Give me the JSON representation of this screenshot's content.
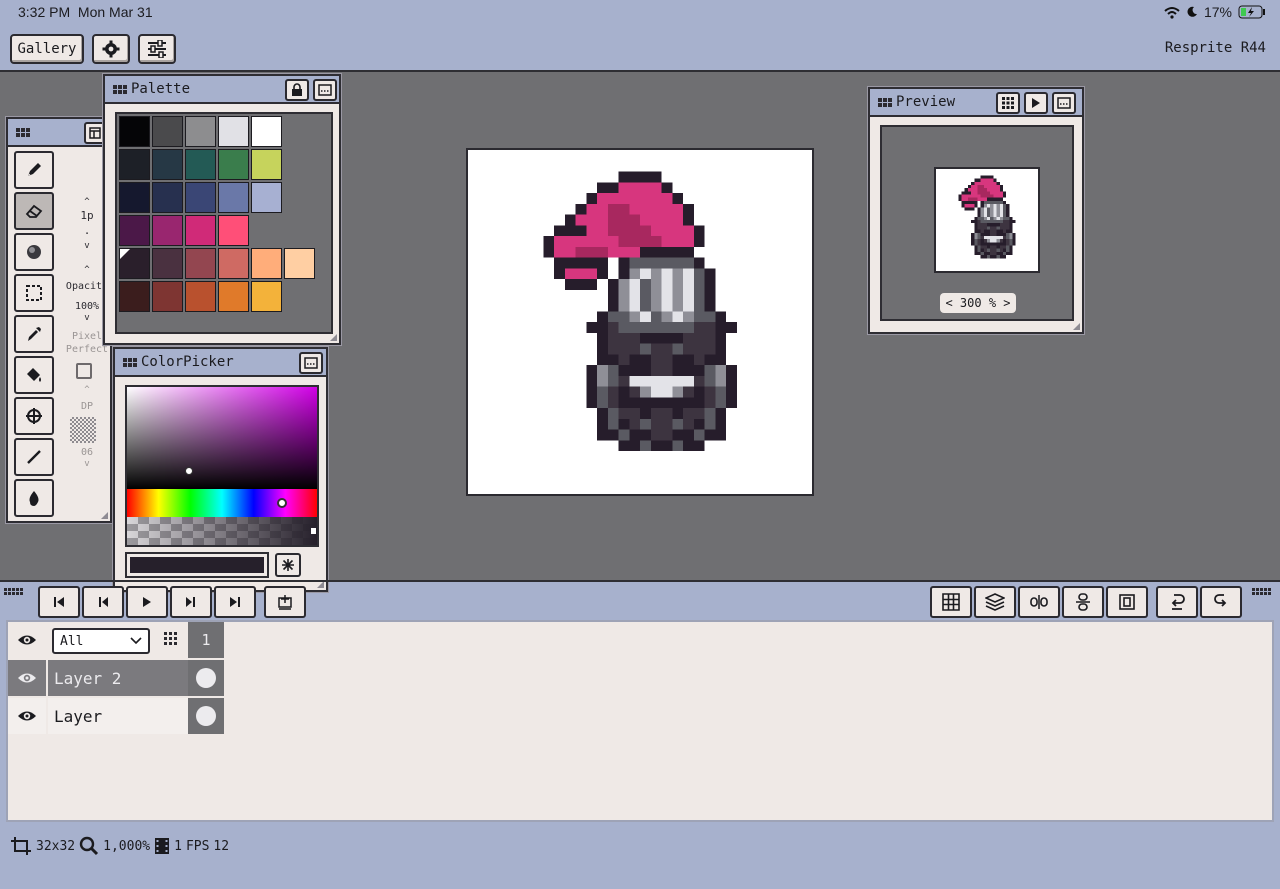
{
  "status_bar": {
    "time": "3:32 PM",
    "date": "Mon Mar 31",
    "battery_percent": "17%",
    "icons": [
      "wifi-icon",
      "moon-icon",
      "battery-charging-icon"
    ]
  },
  "toolbar": {
    "gallery_label": "Gallery",
    "app_name": "Resprite R44",
    "icons": [
      "settings-icon",
      "sliders-icon"
    ]
  },
  "palette": {
    "title": "Palette",
    "colors": [
      [
        "#050507",
        "#4a4a4c",
        "#8d8d8f",
        "#e1e1e6",
        "#ffffff"
      ],
      [
        "#1d2027",
        "#263845",
        "#235a55",
        "#3a7d4c",
        "#c6d35c"
      ],
      [
        "#15182e",
        "#27304f",
        "#3a4675",
        "#6a78a8",
        "#a7b0d2"
      ],
      [
        "#4b1848",
        "#99266f",
        "#d02a78",
        "#ff4f78"
      ],
      [
        "#2a1f2b",
        "#4a3140",
        "#934650",
        "#cf6a63",
        "#ffad7a",
        "#ffcfa3"
      ],
      [
        "#3b1d1d",
        "#7e3532",
        "#b9512e",
        "#e07a2a",
        "#f3b23a"
      ]
    ],
    "selected_row": 4,
    "selected_col": 0
  },
  "color_picker": {
    "title": "ColorPicker",
    "current_color": "#26202b"
  },
  "tools": {
    "items": [
      "pencil-icon",
      "eraser-icon",
      "shade-icon",
      "select-icon",
      "eyedropper-icon",
      "fill-icon",
      "move-icon",
      "line-icon",
      "dither-icon"
    ],
    "selected": 1,
    "size_label": "1p",
    "opacity_label": "Opacity",
    "opacity_value": "100%",
    "pixel_perfect_label_1": "Pixel",
    "pixel_perfect_label_2": "Perfect",
    "dp_label": "DP",
    "dp_value": "06"
  },
  "preview": {
    "title": "Preview",
    "zoom": "< 300 % >"
  },
  "layers": {
    "filter_value": "All",
    "frame_number": "1",
    "rows": [
      {
        "name": "Layer 2",
        "selected": true
      },
      {
        "name": "Layer",
        "selected": false
      }
    ]
  },
  "footer": {
    "canvas_size": "32x32",
    "zoom": "1,000%",
    "frames": "1",
    "fps_label": "FPS",
    "fps_value": "12"
  },
  "sprite": {
    "palette": {
      "a": "#d7367e",
      "b": "#a8285f",
      "d": "#261d2b",
      "g": "#5a5a62",
      "h": "#8f8f97",
      "w": "#e3e3e8",
      "m": "#3d3440",
      "e": "#706e76"
    },
    "rows": [
      "................................",
      "................................",
      "..............dddd..............",
      "............ddaaaad.............",
      "...........daaaaaaad............",
      "..........daabbaaaaad...........",
      ".........daaabbbaaaad...........",
      "........dddaabbbbaaaad..........",
      ".......daaaaaabbbbaaad..........",
      ".......daabbbaaaddddd...........",
      "........ddddd.dggggggd..........",
      "........daaad.dhwhwhwgd.........",
      ".........ddd.dhwghwhwgd.........",
      ".............dhwghwhwgd.........",
      ".............dhwghwhwgd.........",
      "............dgghwghwhggd........",
      "...........ddmgggggggmmdd.......",
      "............dmmmddddmmmd........",
      "............dmmmgmmgmmmd........",
      "............ddmddmmddmdd........",
      "...........dhgdddmmdddghd.......",
      "...........dhgmwwwwwwmghd.......",
      "...........dgmdmhwwhmdmgd.......",
      "...........dgmddddddddmgd.......",
      "............dgmmdmmdmmgd........",
      "............dgdmgmmgmdgd........",
      "............ddgddmmddgdd........",
      "..............ddgddgdd..........",
      "................................",
      "................................",
      "................................",
      "................................"
    ]
  }
}
